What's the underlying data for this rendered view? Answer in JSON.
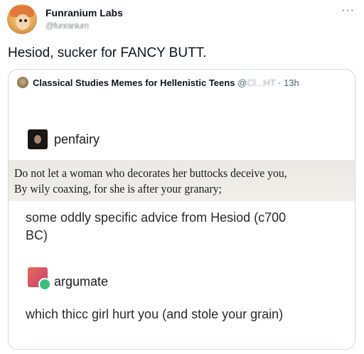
{
  "tweet": {
    "author_name": "Funranium Labs",
    "author_handle": "@funranium",
    "more_label": "···",
    "text": "Hesiod, sucker for FANCY BUTT."
  },
  "quote": {
    "account_name": "Classical Studies Memes for Hellenistic Teens",
    "handle_visible": "@",
    "handle_obscured": "Cl...HT",
    "separator": "·",
    "timestamp": "13h",
    "post": {
      "user1": "penfairy",
      "quote_line1": "Do not let a woman who decorates her buttocks deceive you,",
      "quote_line2": "By wily coaxing, for she is after your granary;",
      "user1_comment_line1": "some oddly specific advice from Hesiod (c700",
      "user1_comment_line2": "BC)",
      "user2": "argumate",
      "user2_comment": "which thicc girl hurt you (and stole your grain)"
    }
  }
}
